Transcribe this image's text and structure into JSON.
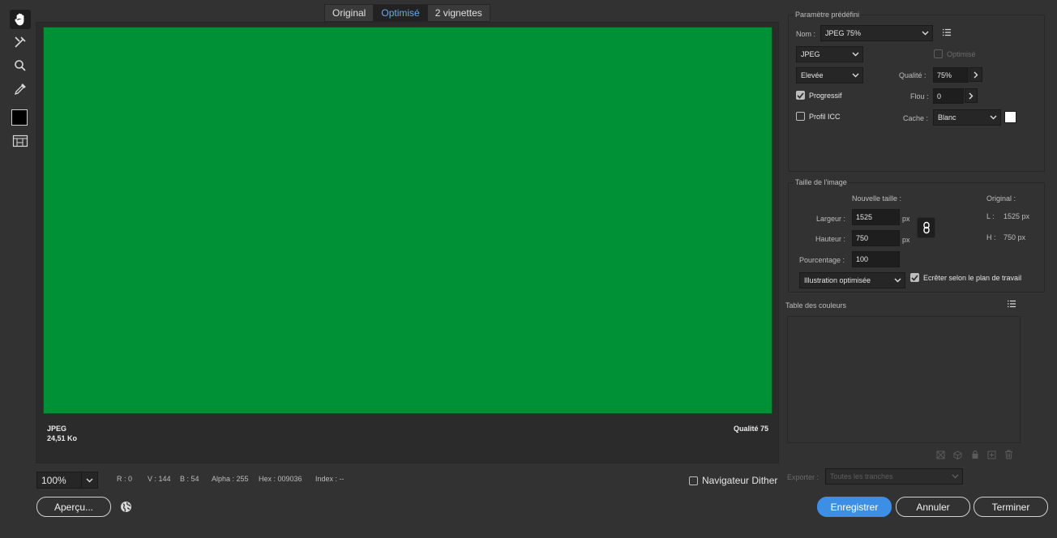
{
  "tabs": [
    {
      "label": "Original",
      "active": false
    },
    {
      "label": "Optimisé",
      "active": true
    },
    {
      "label": "2 vignettes",
      "active": false
    }
  ],
  "tools": [
    "hand-tool-icon",
    "slice-select-icon",
    "zoom-icon",
    "eyedropper-icon",
    "eyedropper-color-swatch",
    "toggle-slices-icon"
  ],
  "preview": {
    "image_color": "#009036",
    "format": "JPEG",
    "size": "24,51 Ko",
    "quality": "Qualité 75"
  },
  "status": {
    "zoom": "100%",
    "r": "R : 0",
    "v": "V : 144",
    "b": "B : 54",
    "alpha": "Alpha : 255",
    "hex": "Hex : 009036",
    "index": "Index : --",
    "dither_label": "Navigateur Dither",
    "dither_checked": false
  },
  "buttons": {
    "preview": "Aperçu...",
    "save": "Enregistrer",
    "cancel": "Annuler",
    "done": "Terminer"
  },
  "preset": {
    "title": "Paramètre prédéfini",
    "name_label": "Nom :",
    "name_value": "JPEG 75%",
    "format_value": "JPEG",
    "optimized_label": "Optimisé",
    "quality_level": "Elevée",
    "quality_label": "Qualité :",
    "quality_value": "75%",
    "progressive_label": "Progressif",
    "progressive_checked": true,
    "blur_label": "Flou :",
    "blur_value": "0",
    "icc_label": "Profil ICC",
    "icc_checked": false,
    "matte_label": "Cache :",
    "matte_value": "Blanc",
    "matte_color": "#ffffff"
  },
  "image_size": {
    "title": "Taille de l'image",
    "new_size_label": "Nouvelle taille :",
    "original_label": "Original :",
    "width_label": "Largeur :",
    "width_value": "1525",
    "height_label": "Hauteur :",
    "height_value": "750",
    "unit": "px",
    "percent_label": "Pourcentage :",
    "percent_value": "100",
    "orig_w_label": "L :",
    "orig_w_value": "1525 px",
    "orig_h_label": "H :",
    "orig_h_value": "750 px",
    "resample_value": "Illustration optimisée",
    "clip_label": "Ecrêter selon le plan de travail",
    "clip_checked": true
  },
  "color_table": {
    "title": "Table des couleurs"
  },
  "export": {
    "label": "Exporter :",
    "value": "Toutes les tranches"
  }
}
